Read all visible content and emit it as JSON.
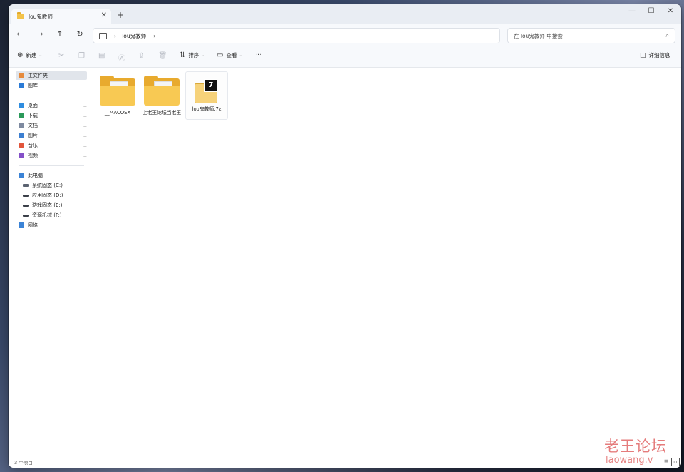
{
  "window": {
    "tab_title": "lou鬼教师",
    "tab_close": "✕",
    "tab_add": "+",
    "controls": [
      "—",
      "☐",
      "✕"
    ]
  },
  "address": {
    "path": "lou鬼教师",
    "search_placeholder": "在 lou鬼教师 中搜索"
  },
  "toolbar": {
    "new": "新建",
    "sort": "排序",
    "view": "查看",
    "more": "···",
    "details": "详细信息"
  },
  "sidebar": {
    "top": [
      {
        "label": "主文件夹",
        "icon": "home-icon",
        "color": "#e58a3c"
      },
      {
        "label": "图库",
        "icon": "gallery-icon",
        "color": "#2b7bd6"
      }
    ],
    "quick": [
      {
        "label": "桌面",
        "icon": "desktop-icon",
        "color": "#2f8de0"
      },
      {
        "label": "下载",
        "icon": "download-icon",
        "color": "#2b9a5a"
      },
      {
        "label": "文档",
        "icon": "document-icon",
        "color": "#7e8aa0"
      },
      {
        "label": "图片",
        "icon": "pictures-icon",
        "color": "#3c7fd1"
      },
      {
        "label": "音乐",
        "icon": "music-icon",
        "color": "#e2553b"
      },
      {
        "label": "视频",
        "icon": "video-icon",
        "color": "#8450c8"
      }
    ],
    "pin_glyph": "📌",
    "pc": {
      "label": "此电脑",
      "icon": "pc-icon",
      "color": "#3b83d6"
    },
    "drives": [
      {
        "label": "系统固态 (C:)",
        "icon": "drive-icon"
      },
      {
        "label": "应用固态 (D:)",
        "icon": "drive-icon"
      },
      {
        "label": "游戏固态 (E:)",
        "icon": "drive-icon"
      },
      {
        "label": "资源机械 (F:)",
        "icon": "drive-icon"
      }
    ],
    "network": {
      "label": "网络",
      "icon": "network-icon",
      "color": "#3b83d6"
    }
  },
  "files": [
    {
      "name": "__MACOSX",
      "type": "folder"
    },
    {
      "name": "上老王论坛当老王",
      "type": "folder"
    },
    {
      "name": "lou鬼教师.7z",
      "type": "archive",
      "badge": "7"
    }
  ],
  "status": {
    "count": "3 个项目"
  },
  "watermark": {
    "line1": "老王论坛",
    "line2": "laowang.v"
  }
}
